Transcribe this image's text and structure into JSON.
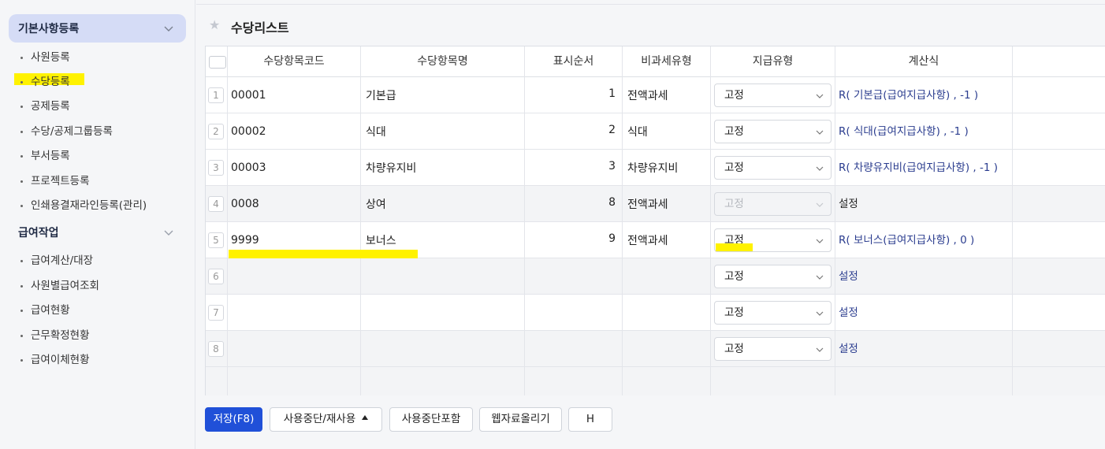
{
  "sidebar": {
    "groups": [
      {
        "label": "기본사항등록",
        "expanded": true
      },
      {
        "label": "급여작업",
        "expanded": true
      }
    ],
    "group1_items": [
      "사원등록",
      "수당등록",
      "공제등록",
      "수당/공제그룹등록",
      "부서등록",
      "프로젝트등록",
      "인쇄용결재라인등록(관리)"
    ],
    "group2_items": [
      "급여계산/대장",
      "사원별급여조회",
      "급여현황",
      "근무확정현황",
      "급여이체현황"
    ],
    "active_item": "수당등록"
  },
  "main": {
    "title": "수당리스트",
    "columns": [
      "수당항목코드",
      "수당항목명",
      "표시순서",
      "비과세유형",
      "지급유형",
      "계산식"
    ],
    "rows": [
      {
        "num": "1",
        "code": "00001",
        "name": "기본급",
        "order": "1",
        "taxfree": "전액과세",
        "paytype": "고정",
        "formula": "R( 기본급(급여지급사항) , -1 )",
        "disabled": false
      },
      {
        "num": "2",
        "code": "00002",
        "name": "식대",
        "order": "2",
        "taxfree": "식대",
        "paytype": "고정",
        "formula": "R( 식대(급여지급사항) , -1 )",
        "disabled": false
      },
      {
        "num": "3",
        "code": "00003",
        "name": "차량유지비",
        "order": "3",
        "taxfree": "차량유지비",
        "paytype": "고정",
        "formula": "R( 차량유지비(급여지급사항) , -1 )",
        "disabled": false
      },
      {
        "num": "4",
        "code": "0008",
        "name": "상여",
        "order": "8",
        "taxfree": "전액과세",
        "paytype": "고정",
        "formula": "설정",
        "disabled": true
      },
      {
        "num": "5",
        "code": "9999",
        "name": "보너스",
        "order": "9",
        "taxfree": "전액과세",
        "paytype": "고정",
        "formula": "R( 보너스(급여지급사항) , 0 )",
        "disabled": false
      },
      {
        "num": "6",
        "code": "",
        "name": "",
        "order": "",
        "taxfree": "",
        "paytype": "고정",
        "formula": "설정",
        "disabled": false
      },
      {
        "num": "7",
        "code": "",
        "name": "",
        "order": "",
        "taxfree": "",
        "paytype": "고정",
        "formula": "설정",
        "disabled": false
      },
      {
        "num": "8",
        "code": "",
        "name": "",
        "order": "",
        "taxfree": "",
        "paytype": "고정",
        "formula": "설정",
        "disabled": false
      }
    ]
  },
  "buttons": {
    "save": "저장(F8)",
    "suspend": "사용중단/재사용",
    "include_suspended": "사용중단포함",
    "web_upload": "웹자료올리기",
    "h": "H"
  },
  "colors": {
    "primary": "#2050d8",
    "sidebar_active_bg": "#d5dcf6",
    "highlight": "#fff200",
    "formula_link": "#2b3d8f"
  }
}
